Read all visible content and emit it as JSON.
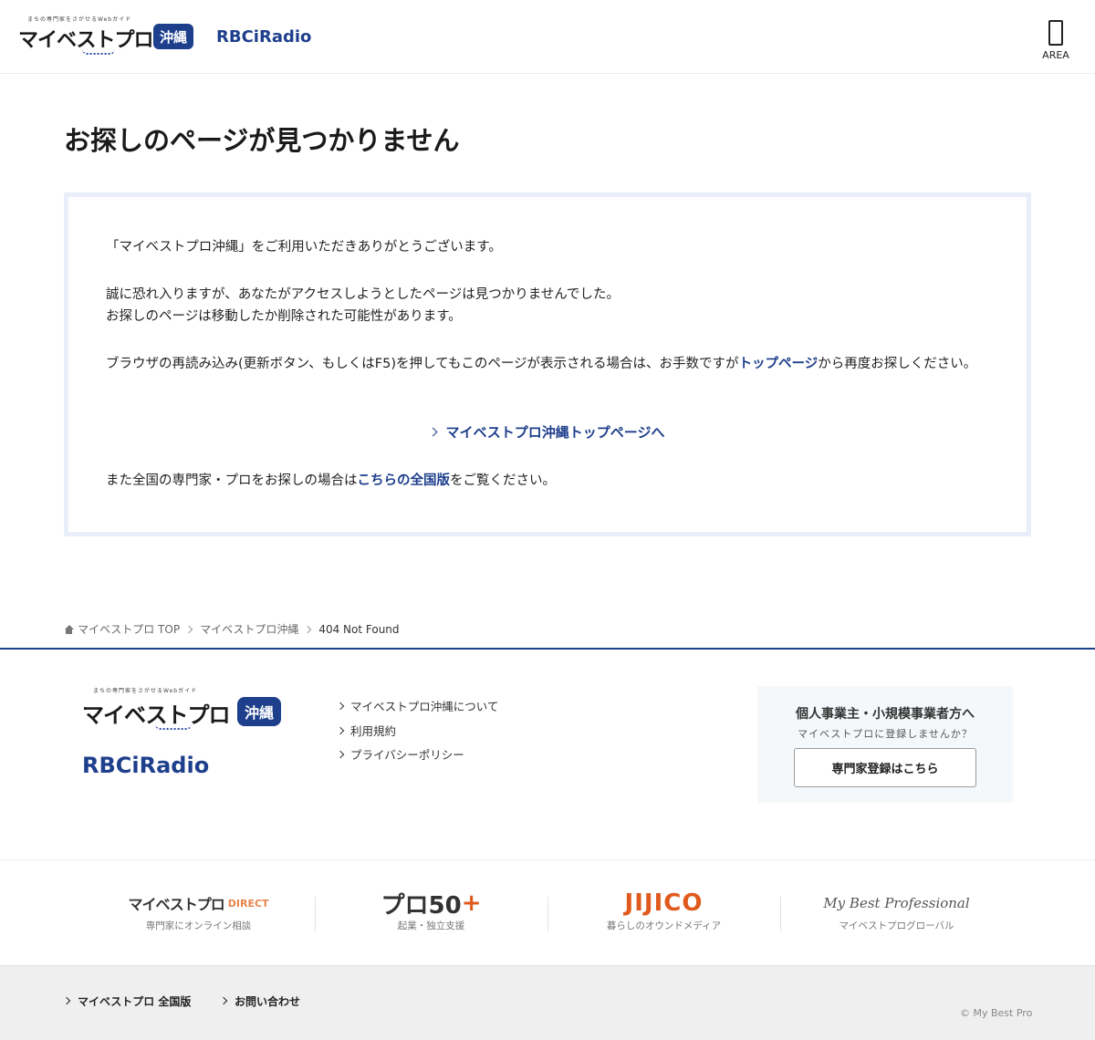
{
  "header": {
    "logo_tagline": "まちの専門家をさがせるWebガイド",
    "logo_name": "マイベストプロ",
    "logo_badge": "沖縄",
    "partner_logo": "RBCiRadio",
    "area_label": "AREA",
    "area_icon": "smartphone-icon"
  },
  "main": {
    "title": "お探しのページが見つかりません",
    "p1": "「マイベストプロ沖縄」をご利用いただきありがとうございます。",
    "p2_line1": "誠に恐れ入りますが、あなたがアクセスしようとしたページは見つかりませんでした。",
    "p2_line2": "お探しのページは移動したか削除された可能性があります。",
    "p3_before": "ブラウザの再読み込み(更新ボタン、もしくはF5)を押してもこのページが表示される場合は、お手数ですが",
    "p3_link": "トップページ",
    "p3_after": "から再度お探しください。",
    "top_link": "マイベストプロ沖縄トップページへ",
    "p4_before": "また全国の専門家・プロをお探しの場合は",
    "p4_link": "こちらの全国版",
    "p4_after": "をご覧ください。",
    "accent_color": "#1e3f8c"
  },
  "breadcrumb": {
    "items": [
      "マイベストプロ TOP",
      "マイベストプロ沖縄"
    ],
    "current": "404 Not Found"
  },
  "footer": {
    "logo_tagline": "まちの専門家をさがせるWebガイド",
    "logo_name": "マイベストプロ",
    "logo_badge": "沖縄",
    "partner_logo": "RBCiRadio",
    "links": [
      "マイベストプロ沖縄について",
      "利用規約",
      "プライバシーポリシー"
    ],
    "register": {
      "heading": "個人事業主・小規模事業者方へ",
      "sub": "マイベストプロに登録しませんか？",
      "button": "専門家登録はこちら"
    },
    "brands": [
      {
        "logo": "マイベストプロ",
        "logo_extra": "DIRECT",
        "caption": "専門家にオンライン相談"
      },
      {
        "logo": "プロ50",
        "logo_extra": "+",
        "caption": "起業・独立支援"
      },
      {
        "logo": "JIJICO",
        "caption": "暮らしのオウンドメディア"
      },
      {
        "logo": "My Best Professional",
        "caption": "マイベストプログローバル"
      }
    ],
    "bottom_links": [
      "マイベストプロ 全国版",
      "お問い合わせ"
    ],
    "copyright": "© My Best Pro"
  }
}
